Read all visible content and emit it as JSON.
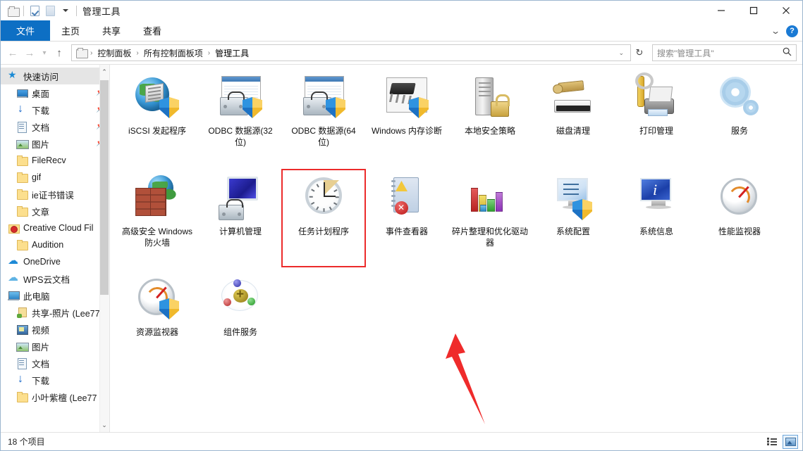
{
  "window": {
    "title": "管理工具",
    "quick_access": [
      "folder-icon",
      "properties-icon",
      "new-folder-icon",
      "customize-caret-icon"
    ],
    "controls": {
      "minimize": "−",
      "maximize": "□",
      "close": "✕"
    }
  },
  "ribbon": {
    "tabs": [
      {
        "label": "文件",
        "active": true
      },
      {
        "label": "主页",
        "active": false
      },
      {
        "label": "共享",
        "active": false
      },
      {
        "label": "查看",
        "active": false
      }
    ],
    "collapse_icon": "chevron-down-icon",
    "help_label": "?"
  },
  "addressbar": {
    "back": "←",
    "forward": "→",
    "recent": "▾",
    "up": "↑",
    "breadcrumbs": [
      "控制面板",
      "所有控制面板项",
      "管理工具"
    ],
    "dropdown_caret": "⌄",
    "refresh": "↻"
  },
  "search": {
    "placeholder": "搜索\"管理工具\"",
    "icon": "search-icon"
  },
  "sidebar": {
    "items": [
      {
        "label": "快速访问",
        "icon": "star-icon",
        "level": 0,
        "selected": true,
        "pinned": false
      },
      {
        "label": "桌面",
        "icon": "desktop-icon",
        "level": 1,
        "selected": false,
        "pinned": true
      },
      {
        "label": "下载",
        "icon": "download-icon",
        "level": 1,
        "selected": false,
        "pinned": true
      },
      {
        "label": "文档",
        "icon": "document-icon",
        "level": 1,
        "selected": false,
        "pinned": true
      },
      {
        "label": "图片",
        "icon": "pictures-icon",
        "level": 1,
        "selected": false,
        "pinned": true
      },
      {
        "label": "FileRecv",
        "icon": "folder-icon",
        "level": 1,
        "selected": false,
        "pinned": false
      },
      {
        "label": "gif",
        "icon": "folder-icon",
        "level": 1,
        "selected": false,
        "pinned": false
      },
      {
        "label": "ie证书错误",
        "icon": "folder-icon",
        "level": 1,
        "selected": false,
        "pinned": false
      },
      {
        "label": "文章",
        "icon": "folder-icon",
        "level": 1,
        "selected": false,
        "pinned": false
      },
      {
        "label": "Creative Cloud Fil",
        "icon": "creative-cloud-icon",
        "level": 0,
        "selected": false,
        "pinned": false
      },
      {
        "label": "Audition",
        "icon": "folder-icon",
        "level": 1,
        "selected": false,
        "pinned": false
      },
      {
        "label": "OneDrive",
        "icon": "onedrive-icon",
        "level": 0,
        "selected": false,
        "pinned": false
      },
      {
        "label": "WPS云文档",
        "icon": "wps-cloud-icon",
        "level": 0,
        "selected": false,
        "pinned": false
      },
      {
        "label": "此电脑",
        "icon": "this-pc-icon",
        "level": 0,
        "selected": false,
        "pinned": false
      },
      {
        "label": "共享-照片 (Lee77",
        "icon": "shared-folder-icon",
        "level": 1,
        "selected": false,
        "pinned": false
      },
      {
        "label": "视频",
        "icon": "videos-icon",
        "level": 1,
        "selected": false,
        "pinned": false
      },
      {
        "label": "图片",
        "icon": "pictures-icon",
        "level": 1,
        "selected": false,
        "pinned": false
      },
      {
        "label": "文档",
        "icon": "document-icon",
        "level": 1,
        "selected": false,
        "pinned": false
      },
      {
        "label": "下载",
        "icon": "download-icon",
        "level": 1,
        "selected": false,
        "pinned": false
      },
      {
        "label": "小叶紫檀 (Lee77",
        "icon": "folder-icon",
        "level": 1,
        "selected": false,
        "pinned": false
      }
    ],
    "scroll_up": "⌃",
    "scroll_down": "⌄"
  },
  "content": {
    "items": [
      {
        "name": "iSCSI 发起程序",
        "art": "iscsi",
        "selected": false
      },
      {
        "name": "ODBC 数据源(32 位)",
        "art": "odbc",
        "selected": false
      },
      {
        "name": "ODBC 数据源(64 位)",
        "art": "odbc",
        "selected": false
      },
      {
        "name": "Windows 内存诊断",
        "art": "memdiag",
        "selected": false
      },
      {
        "name": "本地安全策略",
        "art": "secpolicy",
        "selected": false
      },
      {
        "name": "磁盘清理",
        "art": "diskclean",
        "selected": false
      },
      {
        "name": "打印管理",
        "art": "printmgmt",
        "selected": false
      },
      {
        "name": "服务",
        "art": "services",
        "selected": false
      },
      {
        "name": "高级安全 Windows 防火墙",
        "art": "firewall",
        "selected": false
      },
      {
        "name": "计算机管理",
        "art": "compmgmt",
        "selected": false
      },
      {
        "name": "任务计划程序",
        "art": "taskscheduler",
        "selected": true
      },
      {
        "name": "事件查看器",
        "art": "eventviewer",
        "selected": false
      },
      {
        "name": "碎片整理和优化驱动器",
        "art": "defrag",
        "selected": false
      },
      {
        "name": "系统配置",
        "art": "msconfig",
        "selected": false
      },
      {
        "name": "系统信息",
        "art": "sysinfo",
        "selected": false
      },
      {
        "name": "性能监视器",
        "art": "perfmon",
        "selected": false
      },
      {
        "name": "资源监视器",
        "art": "resmon",
        "selected": false
      },
      {
        "name": "组件服务",
        "art": "compservices",
        "selected": false
      }
    ],
    "highlight_color": "#ec2b2b",
    "annotation_arrow_color": "#ef2b2b"
  },
  "statusbar": {
    "count_label": "18 个项目",
    "details_view_icon": "details-view-icon",
    "large_icons_view_icon": "large-icons-view-icon",
    "active_view": "large-icons"
  }
}
